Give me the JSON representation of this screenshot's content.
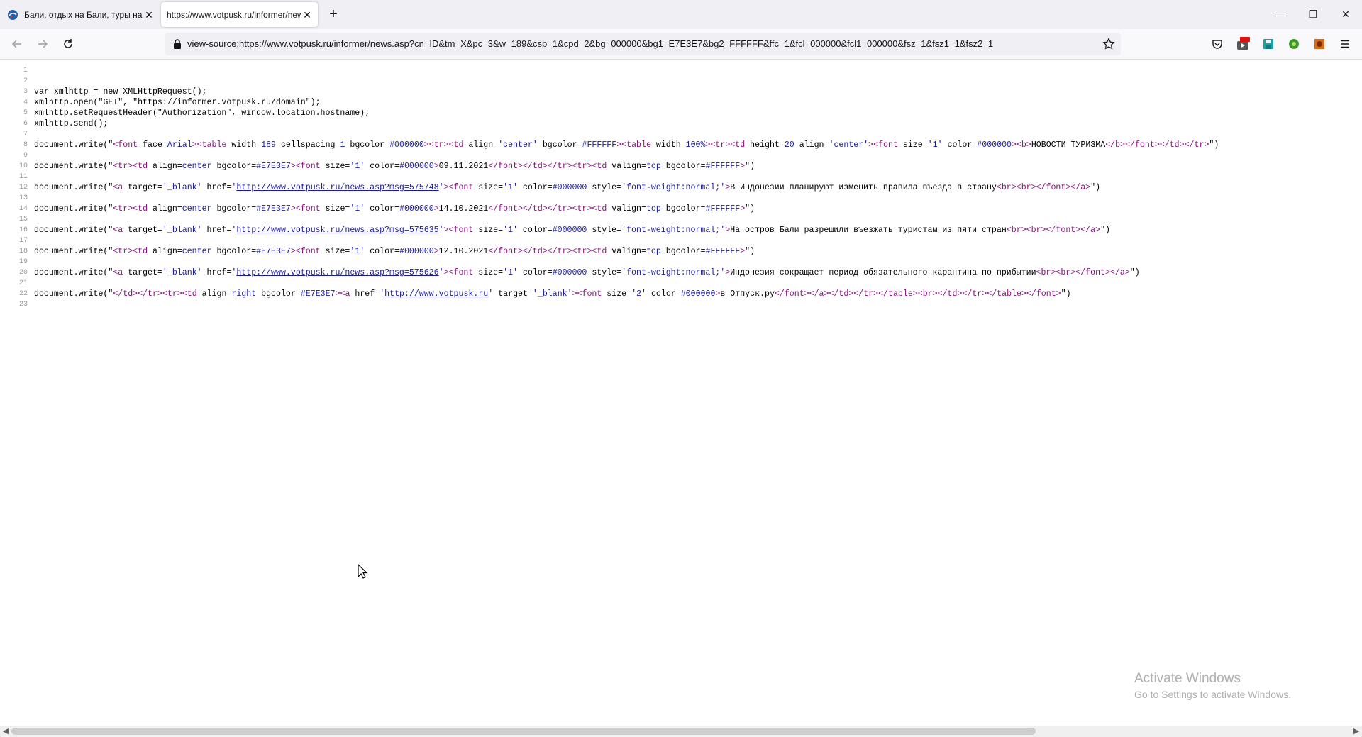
{
  "browser": {
    "tabs": [
      {
        "title": "Бали, отдых на Бали, туры на Бали",
        "active": false
      },
      {
        "title": "https://www.votpusk.ru/informer/news.asp?cn=ID&tm=X",
        "active": true
      }
    ],
    "new_tab_label": "+",
    "url": "view-source:https://www.votpusk.ru/informer/news.asp?cn=ID&tm=X&pc=3&w=189&csp=1&cpd=2&bg=000000&bg1=E7E3E7&bg2=FFFFFF&ffc=1&fcl=000000&fcl1=000000&fsz=1&fsz1=1&fsz2=1",
    "window_controls": {
      "minimize": "—",
      "maximize": "❐",
      "close": "✕"
    },
    "extension_badge": "NEW"
  },
  "source": {
    "line_numbers": [
      "1",
      "2",
      "3",
      "4",
      "5",
      "6",
      "7",
      "8",
      "9",
      "10",
      "11",
      "12",
      "13",
      "14",
      "15",
      "16",
      "17",
      "18",
      "19",
      "20",
      "21",
      "22",
      "23"
    ],
    "lines": [
      "",
      "",
      "var xmlhttp = new XMLHttpRequest();",
      "xmlhttp.open(\"GET\", \"https://informer.votpusk.ru/domain\");",
      "xmlhttp.setRequestHeader(\"Authorization\", window.location.hostname);",
      "xmlhttp.send();",
      "",
      "document.write(\"<font face=Arial><table width=189 cellspacing=1 bgcolor=#000000><tr><td align='center' bgcolor=#FFFFFF><table width=100%><tr><td height=20 align='center'><font size='1' color=#000000><b>НОВОСТИ ТУРИЗМА</b></font></td></tr>\")",
      "",
      "document.write(\"<tr><td align=center bgcolor=#E7E3E7><font size='1' color=#000000>09.11.2021</font></td></tr><tr><td valign=top bgcolor=#FFFFFF>\")",
      "",
      "document.write(\"<a target='_blank' href='http://www.votpusk.ru/news.asp?msg=575748'><font size='1' color=#000000 style='font-weight:normal;'>В Индонезии планируют изменить правила въезда в страну<br><br></font></a>\")",
      "",
      "document.write(\"<tr><td align=center bgcolor=#E7E3E7><font size='1' color=#000000>14.10.2021</font></td></tr><tr><td valign=top bgcolor=#FFFFFF>\")",
      "",
      "document.write(\"<a target='_blank' href='http://www.votpusk.ru/news.asp?msg=575635'><font size='1' color=#000000 style='font-weight:normal;'>На остров Бали разрешили въезжать туристам из пяти стран<br><br></font></a>\")",
      "",
      "document.write(\"<tr><td align=center bgcolor=#E7E3E7><font size='1' color=#000000>12.10.2021</font></td></tr><tr><td valign=top bgcolor=#FFFFFF>\")",
      "",
      "document.write(\"<a target='_blank' href='http://www.votpusk.ru/news.asp?msg=575626'><font size='1' color=#000000 style='font-weight:normal;'>Индонезия сокращает период обязательного карантина по прибытии<br><br></font></a>\")",
      "",
      "document.write(\"</td></tr><tr><td align=right bgcolor=#E7E3E7><a href='http://www.votpusk.ru' target='_blank'><font size='2' color=#000000>в Отпуск.ру</font></a></td></tr></table><br></td></tr></table></font>\")",
      ""
    ]
  },
  "watermark": {
    "title": "Activate Windows",
    "subtitle": "Go to Settings to activate Windows."
  },
  "colors": {
    "tag": "#881280",
    "value": "#1a1aa6",
    "line_number": "#9a9a9a",
    "tab_strip": "#f0f0f4"
  }
}
